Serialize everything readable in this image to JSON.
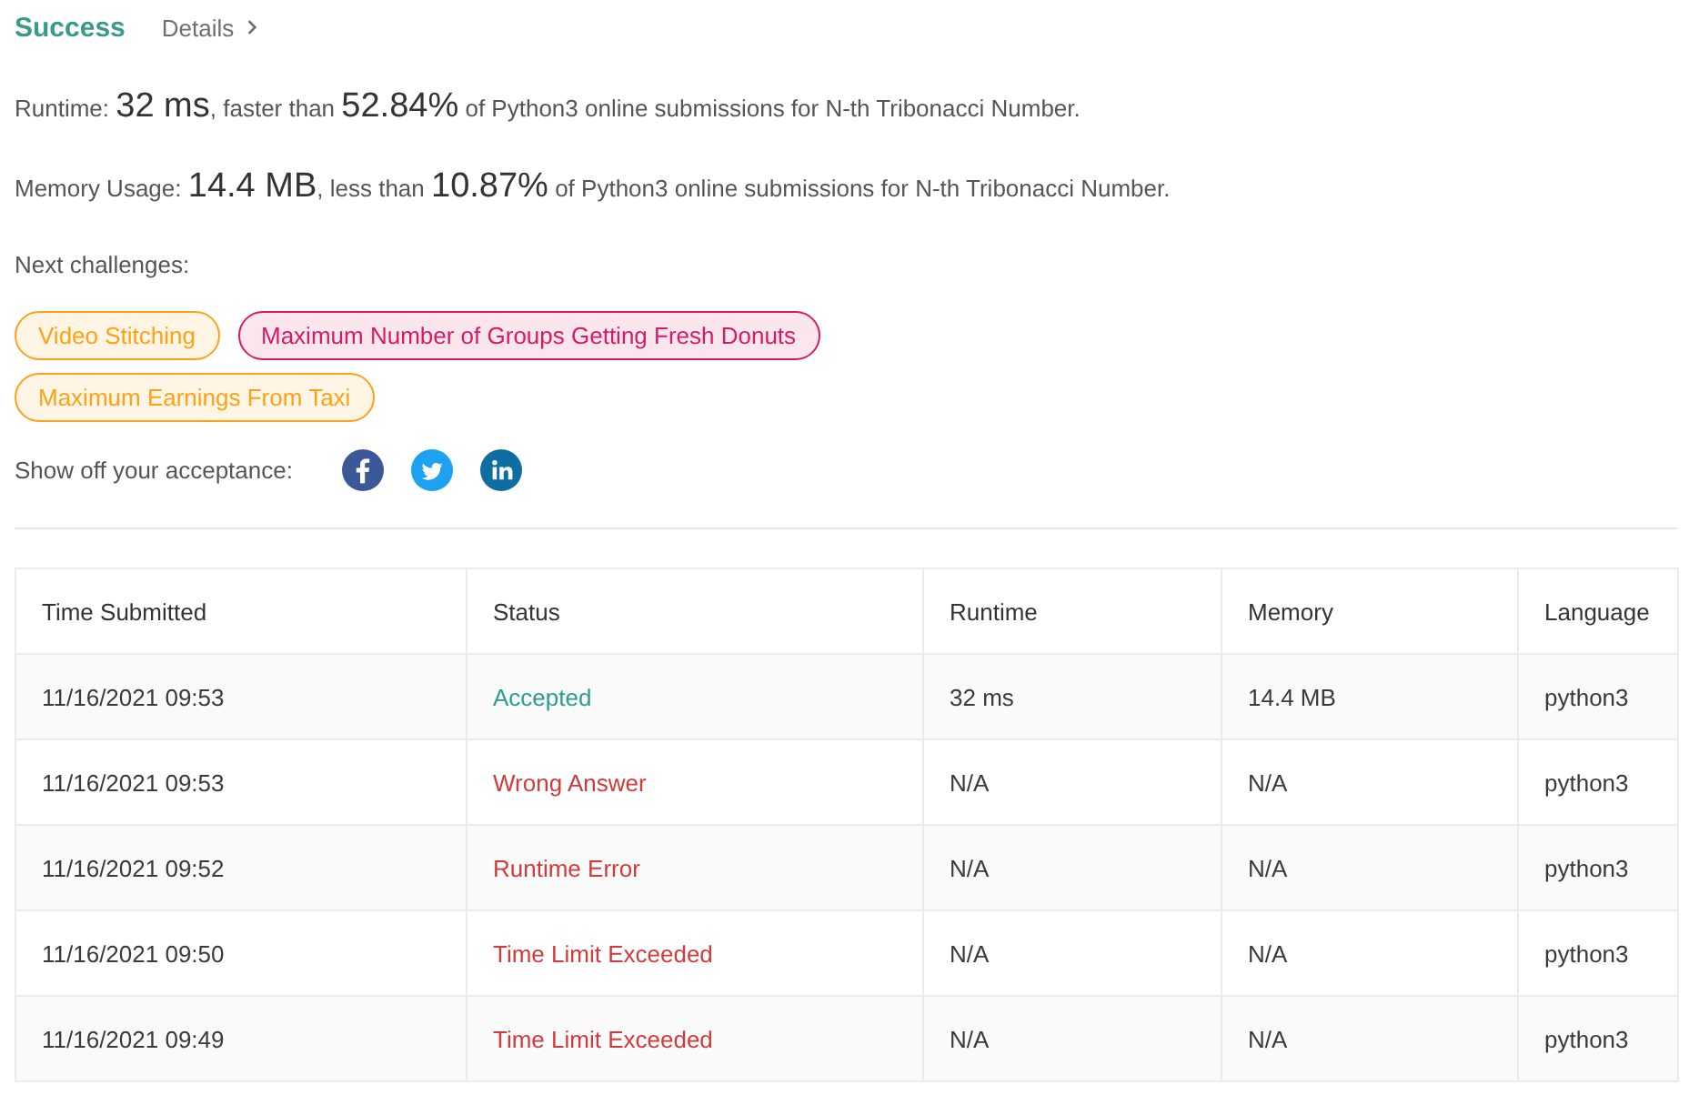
{
  "header": {
    "title": "Success",
    "link": "Details"
  },
  "stats": [
    {
      "label": "Runtime:",
      "value": "32 ms",
      "middle": ", faster than",
      "percent": "52.84%",
      "tail": "of Python3 online submissions for N-th Tribonacci Number."
    },
    {
      "label": "Memory Usage:",
      "value": "14.4 MB",
      "middle": ", less than",
      "percent": "10.87%",
      "tail": "of Python3 online submissions for N-th Tribonacci Number."
    }
  ],
  "next_challenges": {
    "label": "Next challenges:",
    "items": [
      {
        "title": "Video Stitching",
        "color": "#ffa116"
      },
      {
        "title": "Maximum Number of Groups Getting Fresh Donuts",
        "color": "#d81b60"
      },
      {
        "title": "Maximum Earnings From Taxi",
        "color": "#ffa116"
      }
    ]
  },
  "share": {
    "label": "Show off your acceptance:"
  },
  "table": {
    "columns": [
      "Time Submitted",
      "Status",
      "Runtime",
      "Memory",
      "Language"
    ],
    "rows": [
      {
        "time": "11/16/2021 09:53",
        "status": "Accepted",
        "color": "#2a9d8f",
        "runtime": "32 ms",
        "memory": "14.4 MB",
        "language": "python3"
      },
      {
        "time": "11/16/2021 09:53",
        "status": "Wrong Answer",
        "color": "#d23a3a",
        "runtime": "N/A",
        "memory": "N/A",
        "language": "python3"
      },
      {
        "time": "11/16/2021 09:52",
        "status": "Runtime Error",
        "color": "#d23a3a",
        "runtime": "N/A",
        "memory": "N/A",
        "language": "python3"
      },
      {
        "time": "11/16/2021 09:50",
        "status": "Time Limit Exceeded",
        "color": "#d23a3a",
        "runtime": "N/A",
        "memory": "N/A",
        "language": "python3"
      },
      {
        "time": "11/16/2021 09:49",
        "status": "Time Limit Exceeded",
        "color": "#d23a3a",
        "runtime": "N/A",
        "memory": "N/A",
        "language": "python3"
      }
    ]
  }
}
